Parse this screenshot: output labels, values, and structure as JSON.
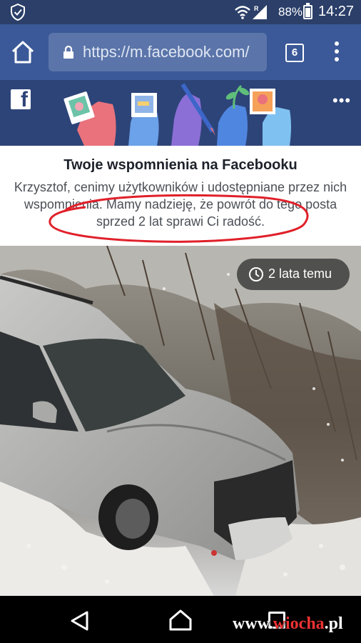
{
  "status_bar": {
    "battery": "88%",
    "time": "14:27",
    "network_letter": "R",
    "icons": [
      "shield-icon",
      "wifi-icon",
      "signal-icon",
      "battery-icon"
    ]
  },
  "browser": {
    "url": "https://m.facebook.com/",
    "tab_count": "6",
    "icons": [
      "home-icon",
      "lock-icon",
      "tabs-icon",
      "overflow-menu-icon"
    ]
  },
  "memory": {
    "title": "Twoje wspomnienia na Facebooku",
    "message": "Krzysztof, cenimy użytkowników i udostępniane przez nich wspomnienia. Mamy nadzieję, że powrót do tego posta sprzed 2 lat sprawi Ci radość.",
    "time_ago": "2 lata temu"
  },
  "watermark": {
    "prefix": "www.",
    "accent": "wiocha",
    "suffix": ".pl"
  },
  "colors": {
    "facebook_blue": "#3b5998",
    "header_dark": "#2d4478",
    "annotation_red": "#e0202a"
  }
}
